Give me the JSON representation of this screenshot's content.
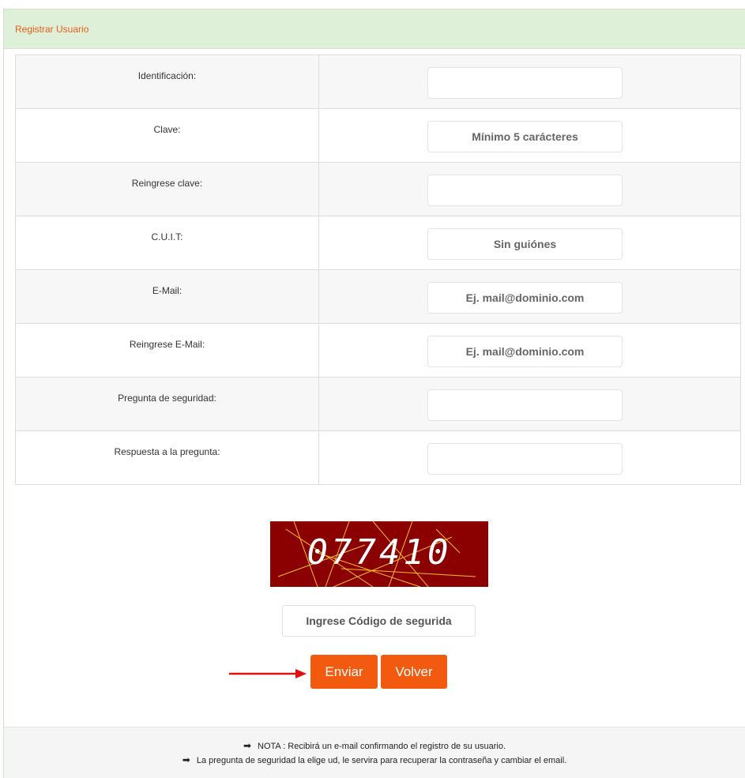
{
  "panel": {
    "title": "Registrar Usuario"
  },
  "form": {
    "fields": [
      {
        "label": "Identificación:",
        "placeholder": ""
      },
      {
        "label": "Clave:",
        "placeholder": "Mínimo 5 carácteres"
      },
      {
        "label": "Reingrese clave:",
        "placeholder": ""
      },
      {
        "label": "C.U.I.T:",
        "placeholder": "Sin guiónes"
      },
      {
        "label": "E-Mail:",
        "placeholder": "Ej. mail@dominio.com"
      },
      {
        "label": "Reingrese E-Mail:",
        "placeholder": "Ej. mail@dominio.com"
      },
      {
        "label": "Pregunta de seguridad:",
        "placeholder": ""
      },
      {
        "label": "Respuesta a la pregunta:",
        "placeholder": ""
      }
    ]
  },
  "captcha": {
    "code": "077410",
    "input_placeholder": "Ingrese Código de segurida"
  },
  "buttons": {
    "send": "Enviar",
    "back": "Volver"
  },
  "footer": {
    "arrow_icon": "right-arrow-icon",
    "note1": "NOTA : Recibirá un e-mail confirmando el registro de su usuario.",
    "note2": "La pregunta de seguridad la elige ud, le servira para recuperar la contraseña y cambiar el email."
  },
  "colors": {
    "accent": "#f25a0f",
    "header_bg": "#dff0d8",
    "captcha_bg": "#8b0000",
    "annotation_arrow": "#e01010"
  }
}
